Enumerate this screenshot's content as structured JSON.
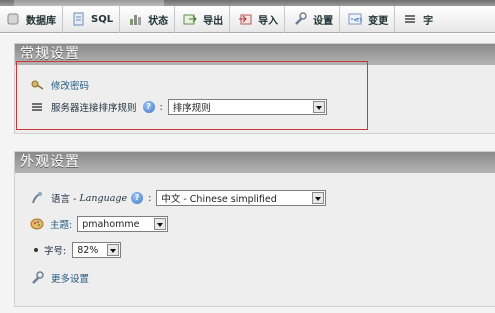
{
  "tabs": [
    {
      "label": "数据库",
      "icon": "database-icon"
    },
    {
      "label": "SQL",
      "icon": "sql-icon"
    },
    {
      "label": "状态",
      "icon": "status-icon"
    },
    {
      "label": "导出",
      "icon": "export-icon"
    },
    {
      "label": "导入",
      "icon": "import-icon"
    },
    {
      "label": "设置",
      "icon": "settings-wrench-icon"
    },
    {
      "label": "变更",
      "icon": "changes-icon"
    },
    {
      "label": "字",
      "icon": "menu-icon"
    }
  ],
  "general": {
    "title": "常规设置",
    "change_password": "修改密码",
    "collation_label": "服务器连接排序规则",
    "collation_value": "排序规则"
  },
  "appearance": {
    "title": "外观设置",
    "language_label": "语言 - ",
    "language_en": "Language",
    "language_value": "中文 - Chinese simplified",
    "theme_label": "主题:",
    "theme_value": "pmahomme",
    "font_label": "字号:",
    "font_value": "82%",
    "more_settings": "更多设置"
  },
  "colors": {
    "panel_header": "#9a9a9a",
    "highlight_border": "#c83a3a",
    "link": "#235a81"
  }
}
